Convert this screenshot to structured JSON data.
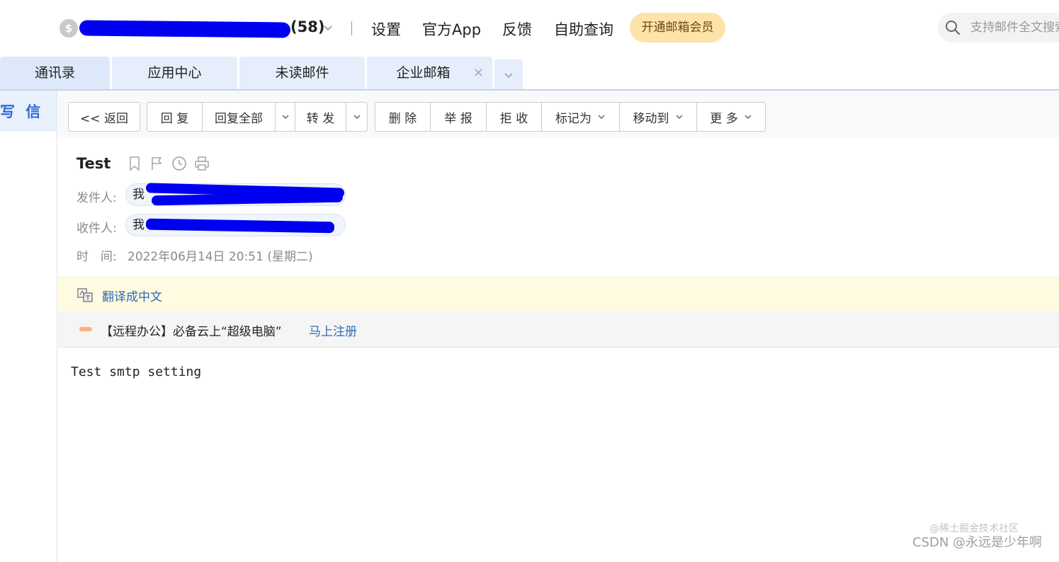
{
  "topbar": {
    "account_count": "(58)",
    "links": [
      "设置",
      "官方App",
      "反馈",
      "自助查询"
    ],
    "vip_button": "开通邮箱会员",
    "search_placeholder": "支持邮件全文搜索"
  },
  "tabs": [
    {
      "label": "通讯录"
    },
    {
      "label": "应用中心"
    },
    {
      "label": "未读邮件"
    },
    {
      "label": "企业邮箱",
      "close": "×"
    }
  ],
  "sidebar": {
    "compose_label": "写 信"
  },
  "toolbar": {
    "back": "<< 返回",
    "reply": "回 复",
    "reply_all": "回复全部",
    "forward": "转 发",
    "delete": "删 除",
    "report": "举 报",
    "reject": "拒 收",
    "mark_as": "标记为",
    "move_to": "移动到",
    "more": "更 多"
  },
  "mail": {
    "subject": "Test",
    "sender_label": "发件人:",
    "sender_name": "我",
    "recipient_label": "收件人:",
    "recipient_name": "我",
    "time_label": "时　间:",
    "time_value": "2022年06月14日 20:51 (星期二)",
    "body": "Test smtp setting"
  },
  "translate": {
    "link": "翻译成中文"
  },
  "ad": {
    "text": "【远程办公】必备云上“超级电脑”",
    "link": "马上注册"
  },
  "watermark": {
    "line1": "@稀土掘金技术社区",
    "line2": "CSDN @永远是少年啊"
  },
  "colors": {
    "accent": "#2f6bd8",
    "link": "#2f6bb8",
    "vip_bg": "#fde3a8",
    "translate_bg": "#fffbe0",
    "redaction": "#0000f0"
  }
}
